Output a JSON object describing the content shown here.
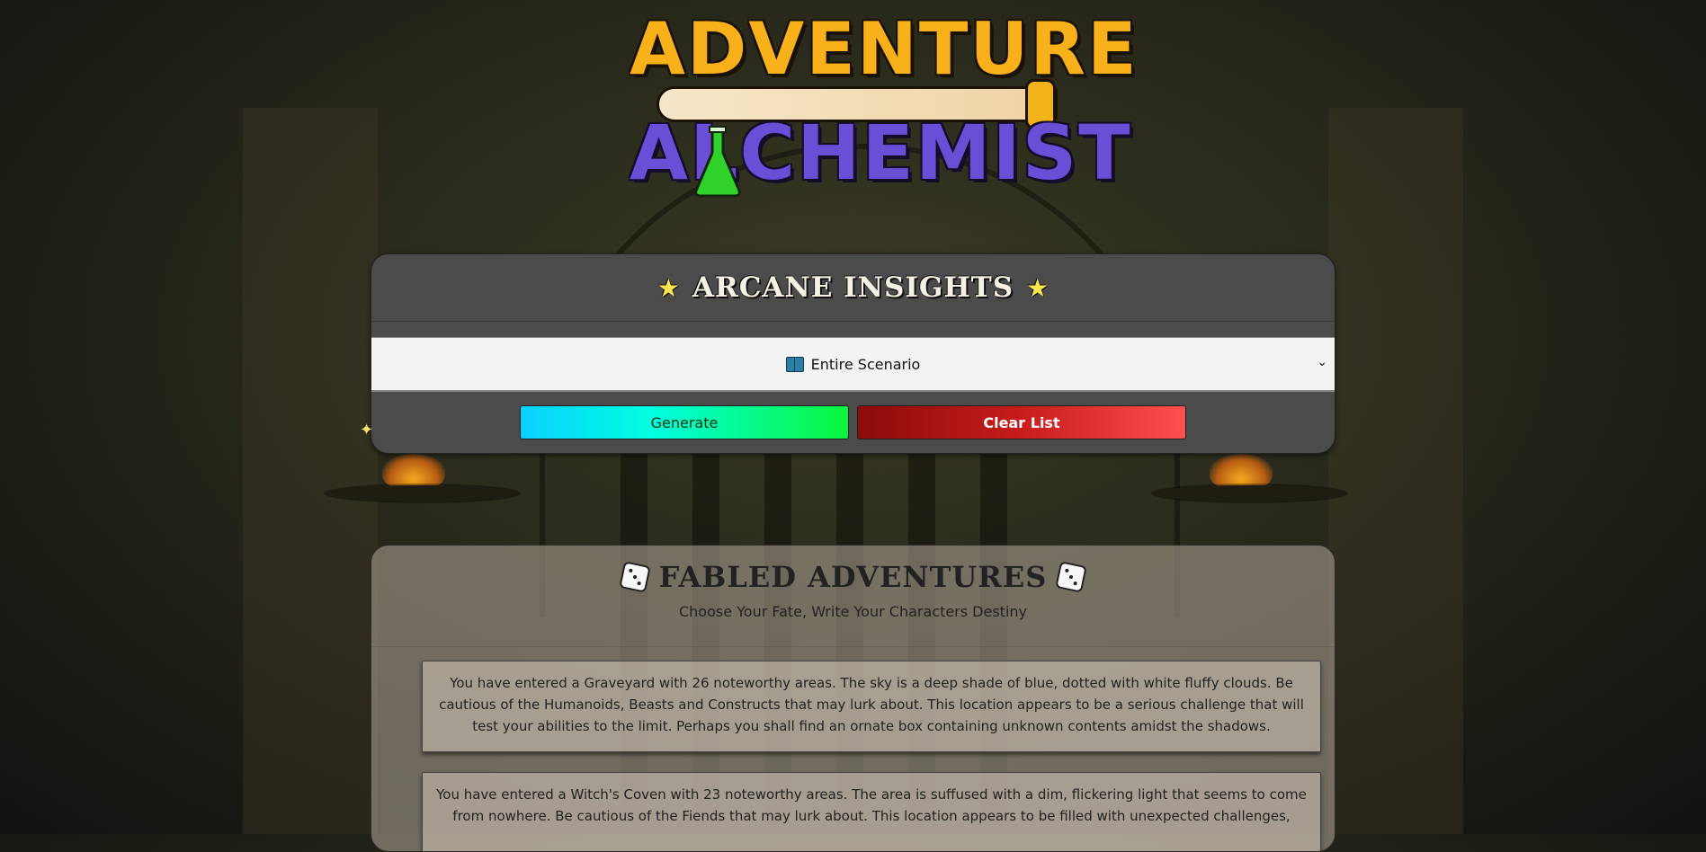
{
  "logo": {
    "line1": "ADVENTURE",
    "line2": "ALCHEMIST"
  },
  "insights": {
    "title": "ARCANE INSIGHTS",
    "scenario_select": {
      "value": "Entire Scenario",
      "icon": "book-icon"
    },
    "generate_label": "Generate",
    "clear_label": "Clear List"
  },
  "adventures": {
    "title": "FABLED ADVENTURES",
    "subtitle": "Choose Your Fate, Write Your Characters Destiny",
    "stories": [
      "You have entered a Graveyard with 26 noteworthy areas. The sky is a deep shade of blue, dotted with white fluffy clouds. Be cautious of the Humanoids, Beasts and Constructs that may lurk about. This location appears to be a serious challenge that will test your abilities to the limit. Perhaps you shall find an ornate box containing unknown contents amidst the shadows.",
      "You have entered a Witch's Coven with 23 noteworthy areas. The area is suffused with a dim, flickering light that seems to come from nowhere. Be cautious of the Fiends that may lurk about. This location appears to be filled with unexpected challenges,"
    ]
  },
  "colors": {
    "logo_gold": "#f8b11a",
    "logo_purple": "#6a4ed6",
    "panel_dark": "#4b4b4b",
    "generate_start": "#0ad0ff",
    "generate_end": "#0bf53c",
    "clear_start": "#8b0b0b",
    "clear_end": "#ff5050"
  }
}
